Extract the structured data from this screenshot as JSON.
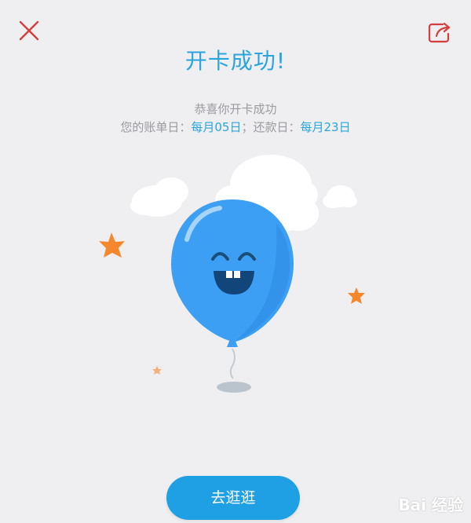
{
  "header": {
    "close_icon": "close-icon",
    "share_icon": "share-icon",
    "accent": "#2aa4dd",
    "close_color": "#d43e3e"
  },
  "main": {
    "title": "开卡成功!",
    "subtitle": "恭喜你开卡成功",
    "billing_label": "您的账单日：",
    "billing_value": "每月05日",
    "separator": "；",
    "repay_label": "还款日：",
    "repay_value": "每月23日"
  },
  "cta": {
    "label": "去逛逛",
    "color": "#1fa0e4"
  },
  "watermark": {
    "text": "Bai 经验"
  }
}
